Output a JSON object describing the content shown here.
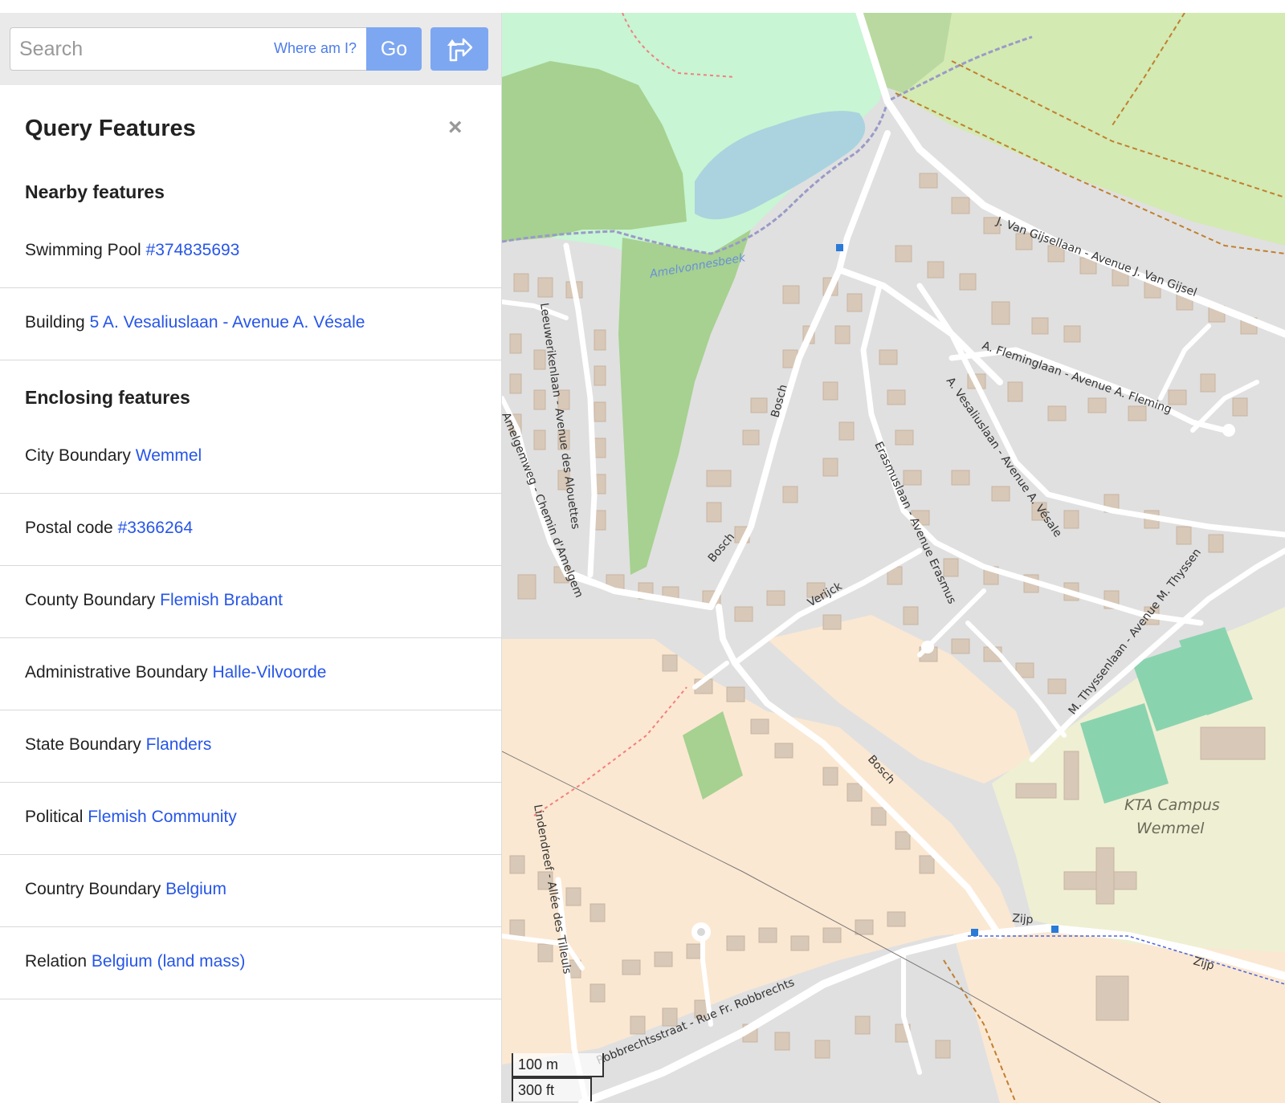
{
  "search": {
    "placeholder": "Search",
    "where_am_i": "Where am I?",
    "go_label": "Go"
  },
  "panel": {
    "title": "Query Features",
    "close": "×"
  },
  "nearby": {
    "heading": "Nearby features",
    "items": [
      {
        "type": "Swimming Pool",
        "link": "#374835693"
      },
      {
        "type": "Building",
        "link": "5 A. Vesaliuslaan - Avenue A. Vésale"
      }
    ]
  },
  "enclosing": {
    "heading": "Enclosing features",
    "items": [
      {
        "type": "City Boundary",
        "link": "Wemmel"
      },
      {
        "type": "Postal code",
        "link": "#3366264"
      },
      {
        "type": "County Boundary",
        "link": "Flemish Brabant"
      },
      {
        "type": "Administrative Boundary",
        "link": "Halle-Vilvoorde"
      },
      {
        "type": "State Boundary",
        "link": "Flanders"
      },
      {
        "type": "Political",
        "link": "Flemish Community"
      },
      {
        "type": "Country Boundary",
        "link": "Belgium"
      },
      {
        "type": "Relation",
        "link": "Belgium (land mass)"
      }
    ]
  },
  "map": {
    "streets": {
      "van_gijsel": "J. Van Gijsellaan - Avenue J. Van Gijsel",
      "fleming": "A. Fleminglaan - Avenue A. Fleming",
      "vesalius": "A. Vesaliuslaan - Avenue A. Vésale",
      "leeuwerik": "Leeuwerikenlaan - Avenue des Alouettes",
      "amelgem": "Amelgemweg - Chemin d'Amelgem",
      "erasmus": "Erasmuslaan - Avenue Erasmus",
      "bosch1": "Bosch",
      "bosch2": "Bosch",
      "bosch3": "Bosch",
      "verijck": "Verijck",
      "thyssen": "M. Thyssenlaan - Avenue M. Thyssen",
      "linden": "Lindendreef - Allée des Tilleuls",
      "zijp1": "Zijp",
      "zijp2": "Zijp",
      "robbrechts": "Robbrechtsstraat - Rue Fr. Robbrechts",
      "amelvonnesbeek": "Amelvonnesbeek"
    },
    "campus_line1": "KTA Campus",
    "campus_line2": "Wemmel",
    "scale_metric": "100 m",
    "scale_imperial": "300 ft",
    "colors": {
      "background": "#e0e0e0",
      "park": "#c8f5d3",
      "grass": "#d3eab2",
      "forest": "#a6d190",
      "residential": "#fbe8d2",
      "school": "#efefd3",
      "pitch": "#8ad3af",
      "water": "#aad3df",
      "building": "#d8c8b8",
      "road": "#ffffff"
    }
  }
}
